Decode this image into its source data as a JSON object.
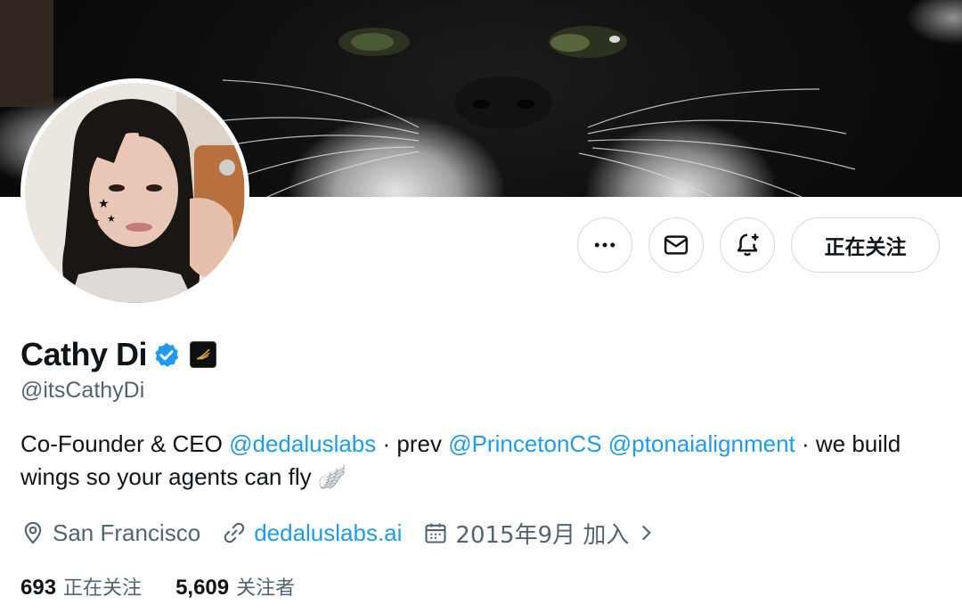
{
  "profile": {
    "display_name": "Cathy Di",
    "handle": "@itsCathyDi",
    "bio": {
      "t1": "Co-Founder & CEO ",
      "m1": "@dedaluslabs",
      "t2": " · prev ",
      "m2": "@PrincetonCS",
      "t3": " ",
      "m3": "@ptonaialignment",
      "t4": " · we build wings so your agents can fly ",
      "emoji": "🪽"
    },
    "location": "San Francisco",
    "website": "dedaluslabs.ai",
    "joined": "2015年9月 加入"
  },
  "actions": {
    "more_icon": "more-horizontal-icon",
    "message_icon": "envelope-icon",
    "notify_icon": "bell-plus-icon",
    "follow_label": "正在关注"
  },
  "stats": {
    "following_count": "693",
    "following_label": "正在关注",
    "followers_count": "5,609",
    "followers_label": "关注者"
  },
  "colors": {
    "accent": "#1d9bf0",
    "text": "#0f1419",
    "secondary": "#536471",
    "border": "#cfd9de"
  }
}
